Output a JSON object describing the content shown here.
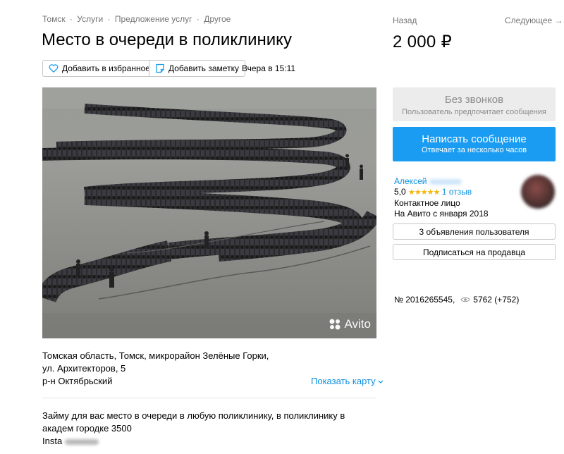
{
  "breadcrumbs": [
    "Томск",
    "Услуги",
    "Предложение услуг",
    "Другое"
  ],
  "breadcrumb_separator": "·",
  "title": "Место в очереди в поликлинику",
  "actions": {
    "favorite_label": "Добавить в избранное",
    "note_label": "Добавить заметку",
    "posted": "Вчера в 15:11"
  },
  "photo": {
    "watermark": "Avito",
    "icon": "avito-logo-icon"
  },
  "address": {
    "line": "Томская область, Томск, микрорайон Зелёные Горки, ул. Архитекторов, 5",
    "district": "р-н Октябрьский",
    "show_map": "Показать карту"
  },
  "description": {
    "text": "Займу для вас место в очереди в любую поликлинику, в поликлинику в академ городке 3500",
    "insta_label": "Insta"
  },
  "nav": {
    "back": "Назад",
    "next": "Следующее →"
  },
  "price": "2 000 ₽",
  "no_calls": {
    "title": "Без звонков",
    "subtitle": "Пользователь предпочитает сообщения"
  },
  "write_message": {
    "title": "Написать сообщение",
    "subtitle": "Отвечает за несколько часов"
  },
  "seller": {
    "name": "Алексей",
    "rating": "5,0",
    "stars": "★★★★★",
    "reviews": "1 отзыв",
    "type": "Контактное лицо",
    "since": "На Авито с января 2018"
  },
  "seller_ads_button": "3 объявления пользователя",
  "subscribe_button": "Подписаться на продавца",
  "listing": {
    "number": "№ 2016265545,",
    "views": "5762 (+752)"
  },
  "colors": {
    "accent": "#1a9cf2",
    "link": "#0a8fe0",
    "star": "#f7b500"
  }
}
